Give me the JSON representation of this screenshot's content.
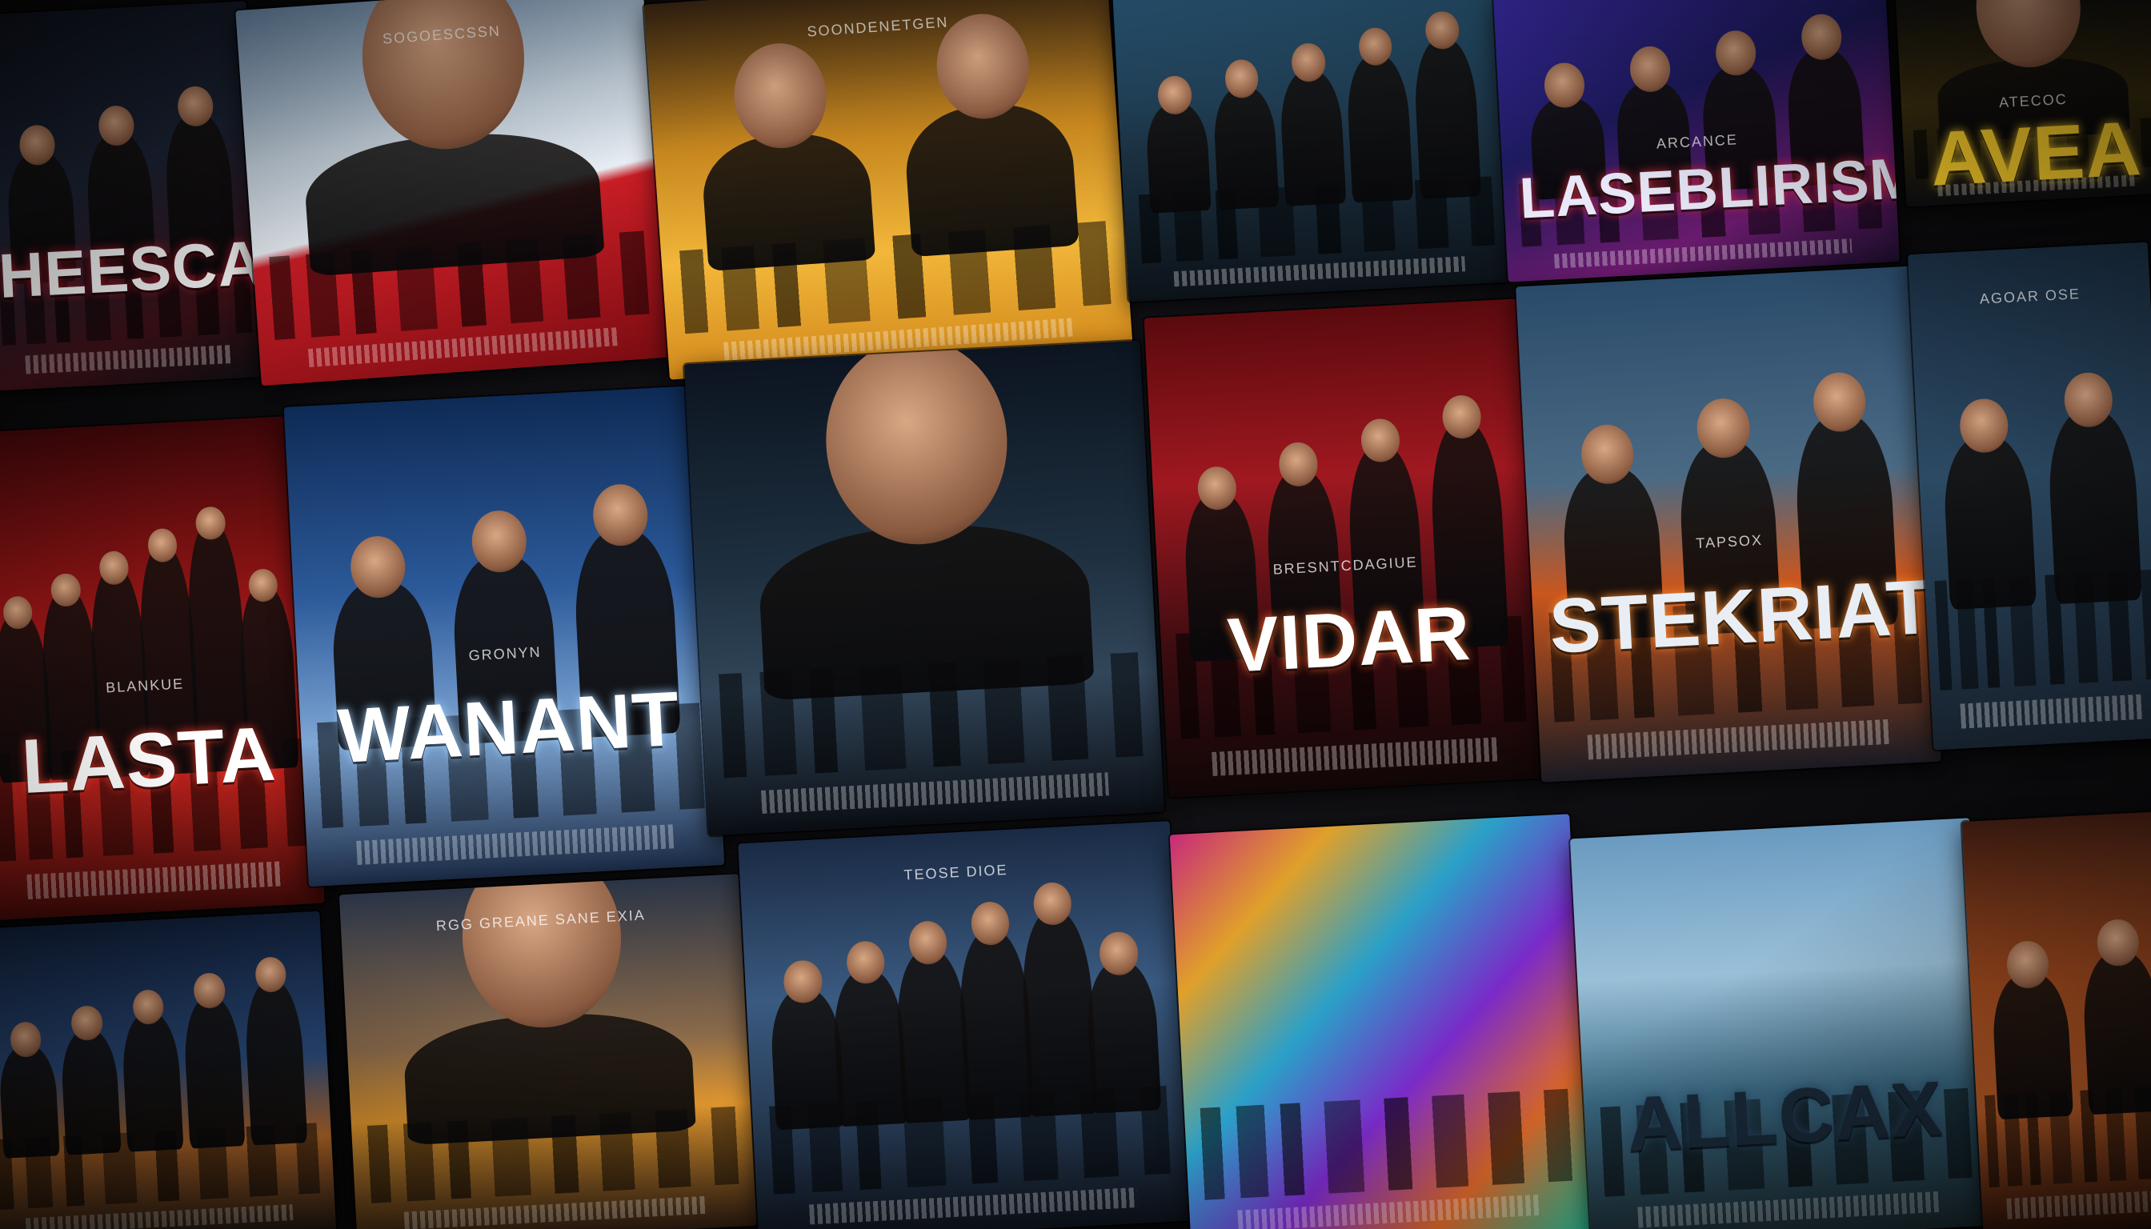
{
  "scene": "movie-poster-wall",
  "posters": [
    {
      "name": "poster-heescak",
      "title": "HEESCAK",
      "subtitle": "",
      "bg": "linear-gradient(160deg,#10141f 0%,#1c2436 45%,#3a1016 80%,#0c0c10 100%)",
      "title_color": "#f2f2f2",
      "accent": "#b0182a",
      "figures": 3
    },
    {
      "name": "poster-sky-red",
      "title": "",
      "subtitle": "SOGOESCSSN",
      "bg": "linear-gradient(170deg,#6f8fb0 0%,#c9d6e2 35%,#e6ecf2 55%,#c81d25 58%,#7a0c12 100%)",
      "title_color": "#ffffff",
      "accent": "#c81d25",
      "figures": 1
    },
    {
      "name": "poster-golden-face",
      "title": "",
      "subtitle": "SOONDENETGEN",
      "bg": "linear-gradient(180deg,#3a2612 0%,#c7871f 40%,#f2b73a 70%,#d38a1c 100%)",
      "title_color": "#1a1208",
      "accent": "#f6c04a",
      "figures": 2
    },
    {
      "name": "poster-ensemble-teal",
      "title": "",
      "subtitle": "",
      "bg": "linear-gradient(180deg,#2a5a7a 0%,#1a2f3f 55%,#0c1218 100%)",
      "title_color": "#ffffff",
      "accent": "#e0a24a",
      "figures": 5
    },
    {
      "name": "poster-purple-crew",
      "title": "LASEBLIRISM",
      "subtitle": "ARCANCE",
      "bg": "linear-gradient(160deg,#3b2ca8 0%,#1d1a5e 40%,#6a1a6c 75%,#1a0e2a 100%)",
      "title_color": "#e8e8f8",
      "accent": "#d42a3e",
      "figures": 4
    },
    {
      "name": "poster-gold-title",
      "title": "AVEA",
      "subtitle": "ATECOC",
      "bg": "linear-gradient(180deg,#0e0e10 0%,#3a2e0e 55%,#0e0e10 100%)",
      "title_color": "#f4c82a",
      "accent": "#f4c82a",
      "figures": 1
    },
    {
      "name": "poster-lasta",
      "title": "LASTA",
      "subtitle": "BLANKUE",
      "bg": "linear-gradient(180deg,#3a0608 0%,#9a1616 40%,#c4231d 70%,#3a0a08 100%)",
      "title_color": "#ffffff",
      "accent": "#e83a2a",
      "figures": 6
    },
    {
      "name": "poster-wanant",
      "title": "WANANT",
      "subtitle": "GRONYN",
      "bg": "linear-gradient(180deg,#0e2a55 0%,#2c5a9a 40%,#7ea6d4 70%,#1a2a44 100%)",
      "title_color": "#ffffff",
      "accent": "#9fd0ff",
      "figures": 3
    },
    {
      "name": "poster-soldier",
      "title": "",
      "subtitle": "",
      "bg": "linear-gradient(180deg,#0c1420 0%,#1e3040 45%,#32465a 70%,#0a0e14 100%)",
      "title_color": "#ffffff",
      "accent": "#8aa0b4",
      "figures": 1
    },
    {
      "name": "poster-vidar",
      "title": "VIDAR",
      "subtitle": "BRESNTCDAGIUE",
      "bg": "linear-gradient(180deg,#5a0a0e 0%,#a01820 35%,#3a0c10 70%,#100606 100%)",
      "title_color": "#ffffff",
      "accent": "#ff6a2a",
      "figures": 4
    },
    {
      "name": "poster-stekriat",
      "title": "STEKRIAT",
      "subtitle": "TAPSOX",
      "bg": "linear-gradient(180deg,#2a4a6a 0%,#4a6a84 40%,#c8561e 62%,#1a1a22 100%)",
      "title_color": "#e8eef4",
      "accent": "#ff8a2a",
      "figures": 3
    },
    {
      "name": "poster-aviator",
      "title": "",
      "subtitle": "AGOAR OSE",
      "bg": "linear-gradient(180deg,#1a2e42 0%,#2c4a64 45%,#16202c 100%)",
      "title_color": "#ffffff",
      "accent": "#9ec0da",
      "figures": 2
    },
    {
      "name": "poster-dusk-city",
      "title": "",
      "subtitle": "",
      "bg": "linear-gradient(180deg,#0e1a30 0%,#2a4a7a 45%,#b86a2a 70%,#1a1410 100%)",
      "title_color": "#ffffff",
      "accent": "#f0a040",
      "figures": 5
    },
    {
      "name": "poster-cloaked",
      "title": "",
      "subtitle": "RGG GREANE SANE EXIA",
      "bg": "linear-gradient(180deg,#2a3446 0%,#8a6a4a 45%,#e0962e 65%,#2a1a10 100%)",
      "title_color": "#ffffff",
      "accent": "#ffb040",
      "figures": 1
    },
    {
      "name": "poster-group-fire",
      "title": "",
      "subtitle": "TEOSE DIOE",
      "bg": "linear-gradient(180deg,#1a2a44 0%,#3a5a80 40%,#22344a 75%,#0c1018 100%)",
      "title_color": "#ffffff",
      "accent": "#ff9a3a",
      "figures": 6
    },
    {
      "name": "poster-collage",
      "title": "",
      "subtitle": "",
      "bg": "linear-gradient(135deg,#c82a7a 0%,#e0a02a 20%,#2aa0c8 40%,#7a2ac8 60%,#e06a2a 80%,#2ac8a0 100%)",
      "title_color": "#ffffff",
      "accent": "#ffffff",
      "figures": 0
    },
    {
      "name": "poster-castle",
      "title": "ALLCAX",
      "subtitle": "",
      "bg": "linear-gradient(180deg,#6a9ac0 0%,#9ac0d8 35%,#3a6a84 65%,#1a2a30 100%)",
      "title_color": "#1a2a3a",
      "accent": "#2a4a6a",
      "figures": 0
    },
    {
      "name": "poster-orange-gunner",
      "title": "",
      "subtitle": "",
      "bg": "linear-gradient(180deg,#3a1a10 0%,#a04a1e 40%,#c8642a 70%,#2a1008 100%)",
      "title_color": "#ffffff",
      "accent": "#ffb06a",
      "figures": 2
    }
  ]
}
